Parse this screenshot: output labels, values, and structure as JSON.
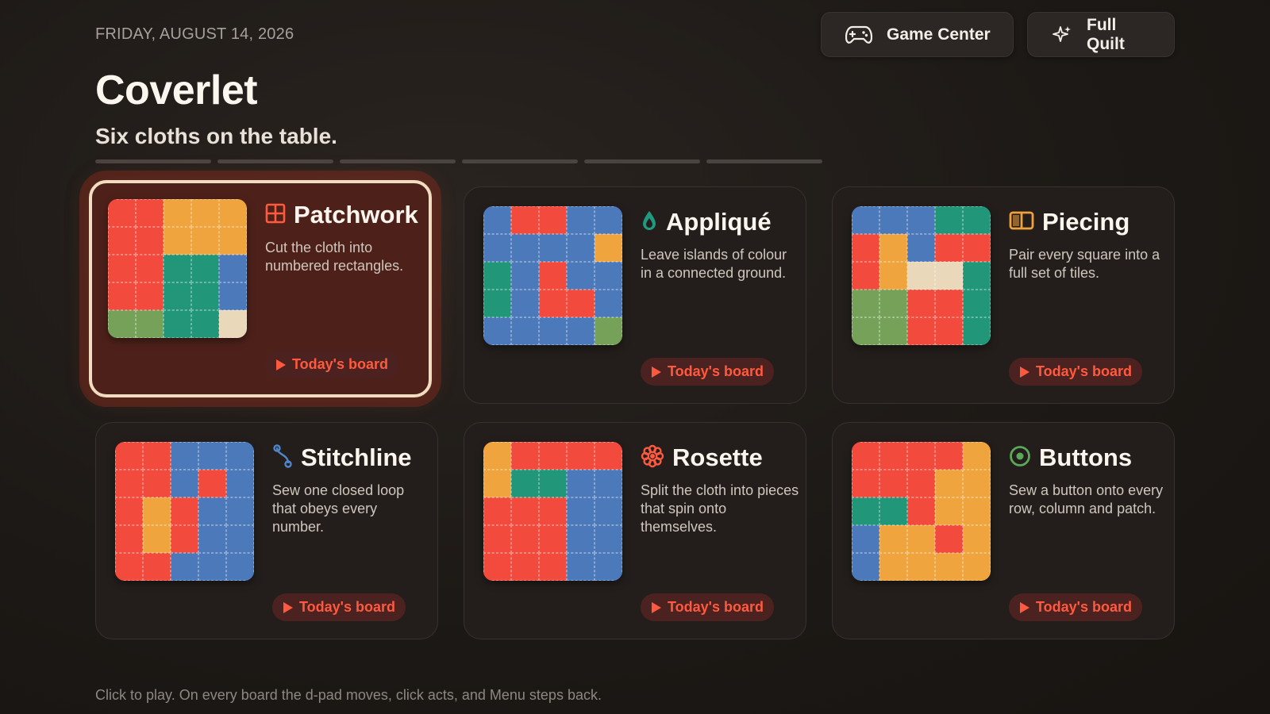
{
  "header": {
    "date": "FRIDAY, AUGUST 14, 2026",
    "title": "Coverlet",
    "subtitle": "Six cloths on the table.",
    "buttons": {
      "game_center": "Game Center",
      "full_quilt": "Full Quilt"
    }
  },
  "progress_segments": 6,
  "colors": {
    "accent": "#ff5a3e",
    "red": "#f24a3c",
    "orange": "#efa43d",
    "blue": "#4b79b9",
    "teal": "#229678",
    "green": "#76a159",
    "cream": "#ead8bb",
    "selected_card": "#4d211a"
  },
  "cards": [
    {
      "name": "Patchwork",
      "icon": "grid-icon",
      "description": "Cut the cloth into numbered rectangles.",
      "play_label": "Today's board",
      "selected": true,
      "grid": [
        "r",
        "r",
        "o",
        "o",
        "o",
        "r",
        "r",
        "o",
        "o",
        "o",
        "r",
        "r",
        "g",
        "g",
        "b",
        "r",
        "r",
        "g",
        "g",
        "b",
        "l",
        "l",
        "g",
        "g",
        "c"
      ]
    },
    {
      "name": "Appliqué",
      "icon": "droplet-icon",
      "description": "Leave islands of colour in a connected ground.",
      "play_label": "Today's board",
      "selected": false,
      "grid": [
        "b",
        "r",
        "r",
        "b",
        "b",
        "b",
        "b",
        "b",
        "b",
        "o",
        "g",
        "b",
        "r",
        "b",
        "b",
        "g",
        "b",
        "r",
        "r",
        "b",
        "b",
        "b",
        "b",
        "b",
        "l"
      ]
    },
    {
      "name": "Piecing",
      "icon": "book-open-icon",
      "description": "Pair every square into a full set of tiles.",
      "play_label": "Today's board",
      "selected": false,
      "grid": [
        "b",
        "b",
        "b",
        "g",
        "g",
        "r",
        "o",
        "b",
        "r",
        "r",
        "r",
        "o",
        "c",
        "c",
        "g",
        "l",
        "l",
        "r",
        "r",
        "g",
        "l",
        "l",
        "r",
        "r",
        "g"
      ]
    },
    {
      "name": "Stitchline",
      "icon": "path-icon",
      "description": "Sew one closed loop that obeys every number.",
      "play_label": "Today's board",
      "selected": false,
      "grid": [
        "r",
        "r",
        "b",
        "b",
        "b",
        "r",
        "r",
        "b",
        "r",
        "b",
        "r",
        "o",
        "r",
        "b",
        "b",
        "r",
        "o",
        "r",
        "b",
        "b",
        "r",
        "r",
        "b",
        "b",
        "b"
      ]
    },
    {
      "name": "Rosette",
      "icon": "flower-icon",
      "description": "Split the cloth into pieces that spin onto themselves.",
      "play_label": "Today's board",
      "selected": false,
      "grid": [
        "o",
        "r",
        "r",
        "r",
        "r",
        "o",
        "g",
        "g",
        "b",
        "b",
        "r",
        "r",
        "r",
        "b",
        "b",
        "r",
        "r",
        "r",
        "b",
        "b",
        "r",
        "r",
        "r",
        "b",
        "b"
      ]
    },
    {
      "name": "Buttons",
      "icon": "target-icon",
      "description": "Sew a button onto every row, column and patch.",
      "play_label": "Today's board",
      "selected": false,
      "grid": [
        "r",
        "r",
        "r",
        "r",
        "o",
        "r",
        "r",
        "r",
        "o",
        "o",
        "g",
        "g",
        "r",
        "o",
        "o",
        "b",
        "o",
        "o",
        "r",
        "o",
        "b",
        "o",
        "o",
        "o",
        "o"
      ]
    }
  ],
  "footer": "Click to play. On every board the d-pad moves, click acts, and Menu steps back."
}
